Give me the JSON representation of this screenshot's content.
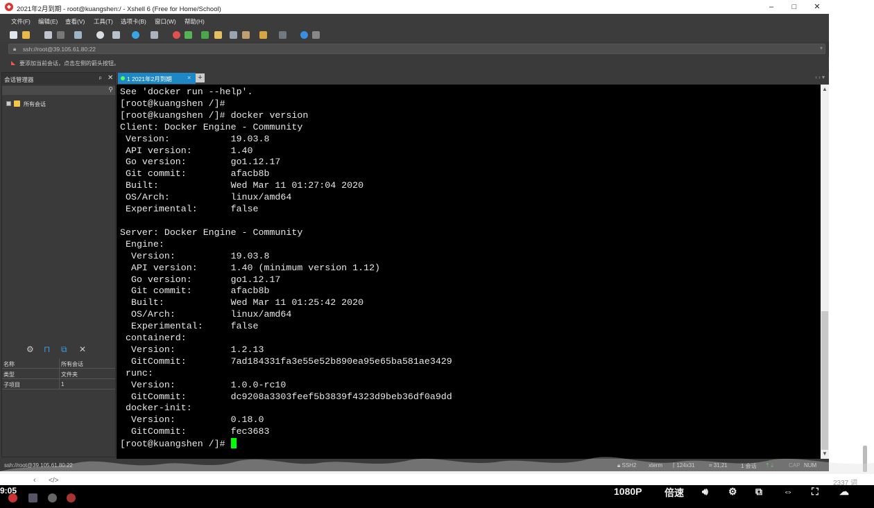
{
  "window": {
    "title": "2021年2月到期 - root@kuangshen:/ - Xshell 6 (Free for Home/School)",
    "minimize": "–",
    "maximize": "□",
    "close": "✕"
  },
  "menu": [
    "文件(F)",
    "编辑(E)",
    "查看(V)",
    "工具(T)",
    "选项卡(B)",
    "窗口(W)",
    "帮助(H)"
  ],
  "address": {
    "value": "ssh://root@39.105.61.80:22"
  },
  "hint": "要添加当前会话，点击左侧的箭头按钮。",
  "session_manager": {
    "title": "会话管理器",
    "pin": "ᵖ",
    "close": "✕",
    "tree_root": "所有会话",
    "properties": [
      {
        "key": "名称",
        "value": "所有会话"
      },
      {
        "key": "类型",
        "value": "文件夹"
      },
      {
        "key": "子项目",
        "value": "1"
      }
    ]
  },
  "tab": {
    "label": "1 2021年2月到期",
    "close": "×",
    "add": "+",
    "nav": "‹ ›  ▾"
  },
  "terminal_lines": [
    "See 'docker run --help'.",
    "[root@kuangshen /]#",
    "[root@kuangshen /]# docker version",
    "Client: Docker Engine - Community",
    " Version:           19.03.8",
    " API version:       1.40",
    " Go version:        go1.12.17",
    " Git commit:        afacb8b",
    " Built:             Wed Mar 11 01:27:04 2020",
    " OS/Arch:           linux/amd64",
    " Experimental:      false",
    "",
    "Server: Docker Engine - Community",
    " Engine:",
    "  Version:          19.03.8",
    "  API version:      1.40 (minimum version 1.12)",
    "  Go version:       go1.12.17",
    "  Git commit:       afacb8b",
    "  Built:            Wed Mar 11 01:25:42 2020",
    "  OS/Arch:          linux/amd64",
    "  Experimental:     false",
    " containerd:",
    "  Version:          1.2.13",
    "  GitCommit:        7ad184331fa3e55e52b890ea95e65ba581ae3429",
    " runc:",
    "  Version:          1.0.0-rc10",
    "  GitCommit:        dc9208a3303feef5b3839f4323d9beb36df0a9dd",
    " docker-init:",
    "  Version:          0.18.0",
    "  GitCommit:        fec3683"
  ],
  "terminal_prompt": "[root@kuangshen /]# ",
  "status": {
    "connection": "ssh://root@39.105.61.80:22",
    "protocol": "SSH2",
    "term": "xterm",
    "size": "124x31",
    "cursor": "31,21",
    "sessions": "1 会话",
    "caps": "CAP",
    "num": "NUM"
  },
  "player": {
    "time": "9:05",
    "quality": "1080P",
    "speed": "倍速",
    "word_count": "2337 词",
    "nav_prev": "‹",
    "nav_code": "</>"
  },
  "colors": {
    "tab_active": "#1e88c7",
    "cursor": "#00ff00",
    "terminal_bg": "#000000"
  }
}
